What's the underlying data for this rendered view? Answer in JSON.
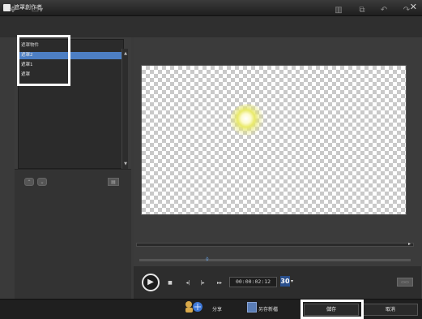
{
  "window": {
    "title": "遮罩創作者",
    "close_glyph": "✕"
  },
  "toolbar": {
    "left_icons": [
      "cursor-tool-icon",
      "mask-dropdown-icon"
    ],
    "right_icons": [
      "import-icon",
      "copy-icon",
      "undo-icon",
      "redo-icon"
    ]
  },
  "object_list": {
    "header": "遮罩物件",
    "items": [
      {
        "label": "遮罩2",
        "selected": true
      },
      {
        "label": "遮罩1",
        "selected": false
      },
      {
        "label": "遮罩",
        "selected": false
      }
    ]
  },
  "playback": {
    "timecode": "00:00:02:12",
    "fps": "30"
  },
  "footer": {
    "share_label": "分享",
    "save_as_label": "另存新檔",
    "save_label": "儲存",
    "cancel_label": "取消"
  },
  "colors": {
    "selection": "#4d7fc4",
    "fps_badge": "#2a4f8c",
    "highlight": "#ffffff"
  }
}
